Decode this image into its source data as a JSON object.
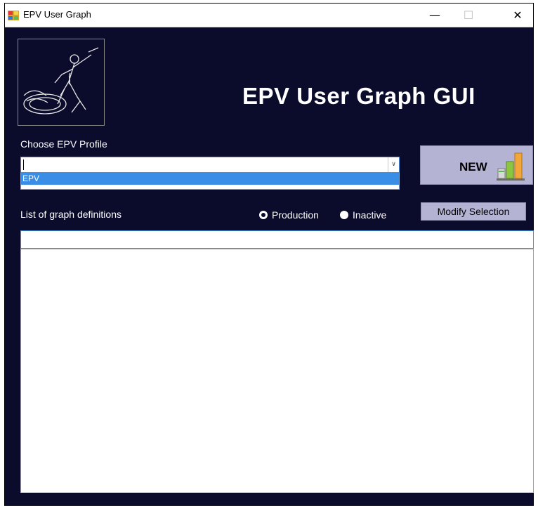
{
  "window": {
    "title": "EPV User Graph",
    "controls": {
      "minimize": "—",
      "maximize": "☐",
      "close": "✕"
    },
    "icon": "app-window-icon"
  },
  "header": {
    "logo_icon": "sword-skeleton-logo",
    "app_title": "EPV User Graph GUI"
  },
  "profile": {
    "label": "Choose EPV Profile",
    "value": "",
    "dropdown_options": [
      "EPV"
    ]
  },
  "new_button": {
    "label": "NEW",
    "icon": "bar-chart-icon"
  },
  "graph_list": {
    "label": "List of graph definitions",
    "radio_options": [
      {
        "label": "Production",
        "selected": true
      },
      {
        "label": "Inactive",
        "selected": false
      }
    ],
    "modify_label": "Modify Selection",
    "filter_value": "",
    "items": []
  },
  "colors": {
    "background": "#0b0b2b",
    "button": "#b5b3d3",
    "highlight": "#3b8ee6",
    "text": "#ffffff"
  }
}
